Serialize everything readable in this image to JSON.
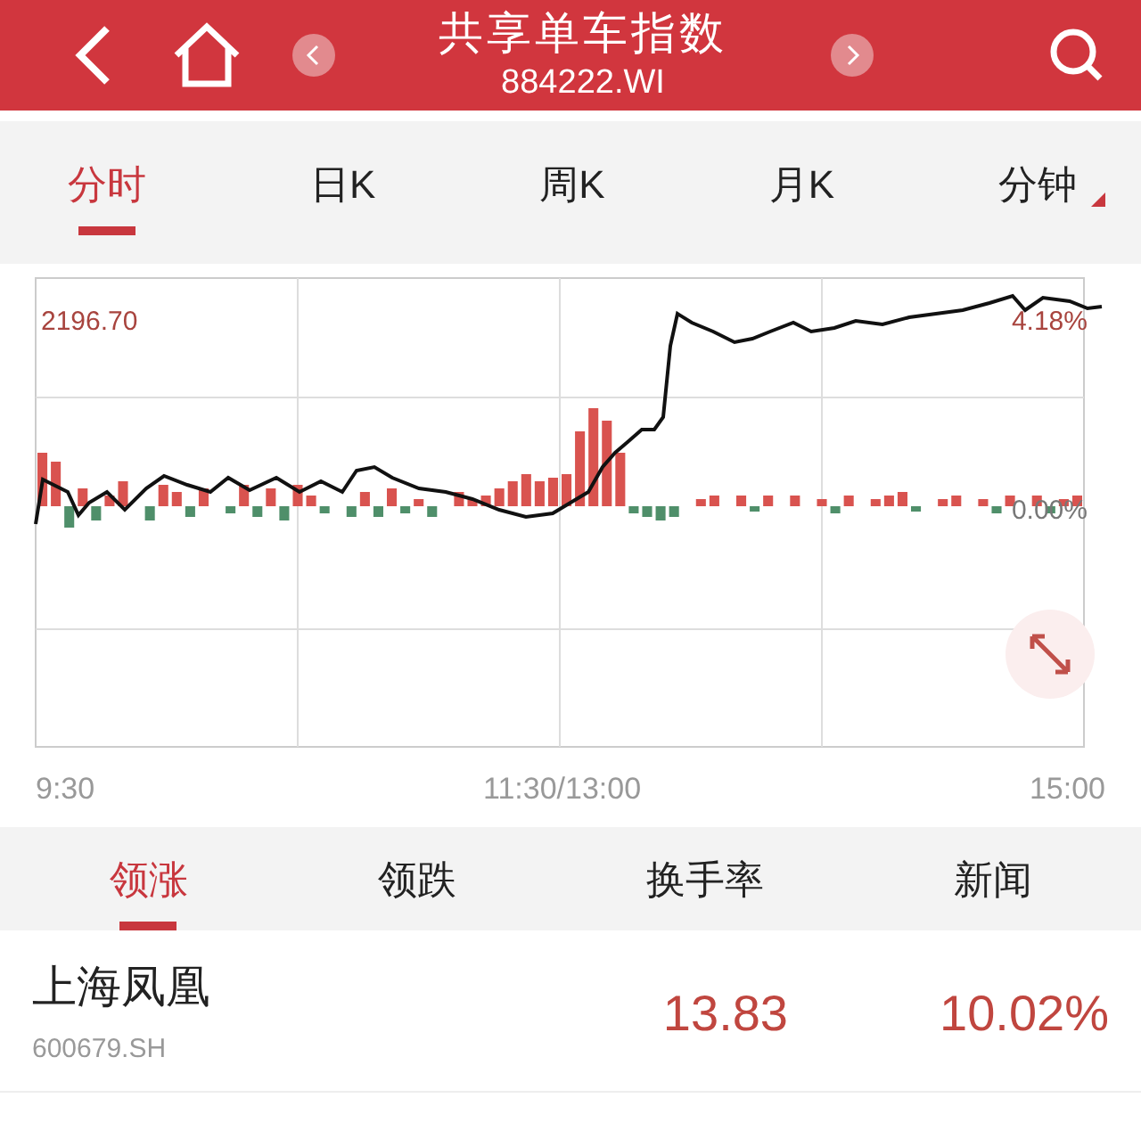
{
  "header": {
    "title": "共享单车指数",
    "code": "884222.WI"
  },
  "period_tabs": [
    {
      "label": "分时",
      "selected": true
    },
    {
      "label": "日K",
      "selected": false
    },
    {
      "label": "周K",
      "selected": false
    },
    {
      "label": "月K",
      "selected": false
    },
    {
      "label": "分钟",
      "selected": false,
      "kind": "dropdown"
    }
  ],
  "chart": {
    "price_high": "2196.70",
    "pct_high": "4.18%",
    "pct_mid": "0.00%",
    "time_labels": [
      "9:30",
      "11:30/13:00",
      "15:00"
    ]
  },
  "list_tabs": [
    {
      "label": "领涨",
      "selected": true
    },
    {
      "label": "领跌",
      "selected": false
    },
    {
      "label": "换手率",
      "selected": false
    },
    {
      "label": "新闻",
      "selected": false
    }
  ],
  "rows": [
    {
      "name": "上海凤凰",
      "code": "600679.SH",
      "price": "13.83",
      "change": "10.02%"
    }
  ]
}
